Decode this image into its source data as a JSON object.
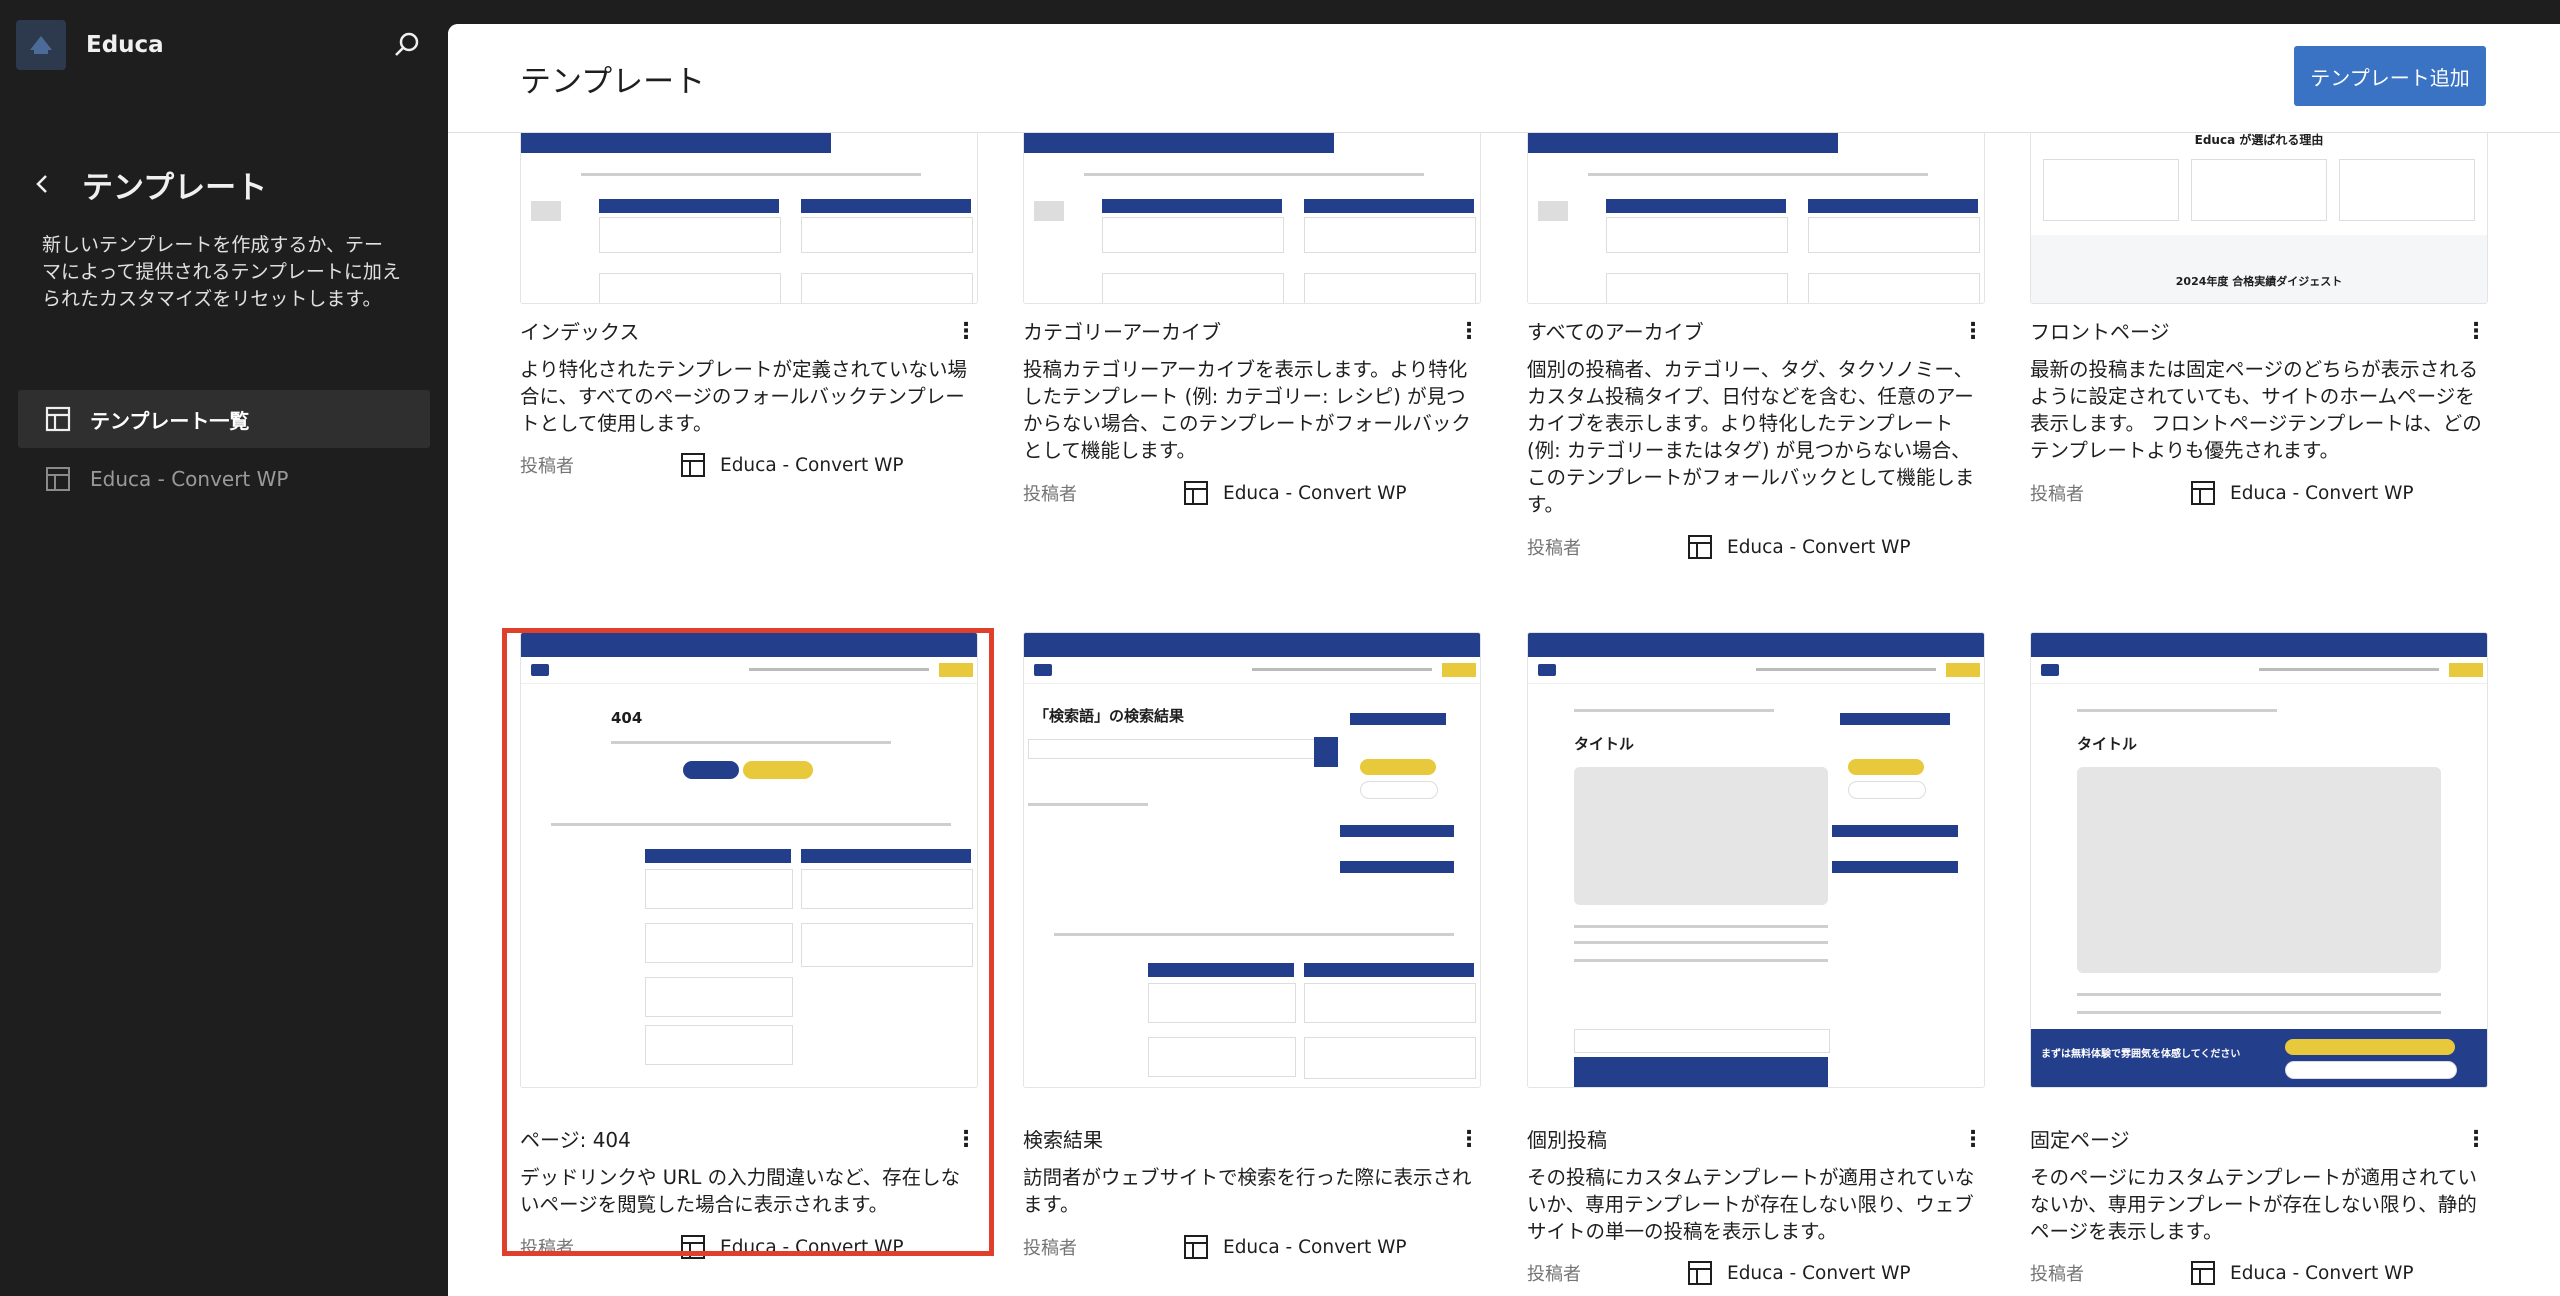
{
  "sidebar": {
    "site_name": "Educa",
    "title": "テンプレート",
    "description": "新しいテンプレートを作成するか、テーマによって提供されるテンプレートに加えられたカスタマイズをリセットします。",
    "items": [
      {
        "label": "テンプレート一覧",
        "active": true
      },
      {
        "label": "Educa - Convert WP",
        "active": false
      }
    ]
  },
  "header": {
    "title": "テンプレート",
    "add_button": "テンプレート追加"
  },
  "meta_label": "投稿者",
  "templates": [
    {
      "title": "インデックス",
      "description": "より特化されたテンプレートが定義されていない場合に、すべてのページのフォールバックテンプレートとして使用します。",
      "author": "Educa - Convert WP"
    },
    {
      "title": "カテゴリーアーカイブ",
      "description": "投稿カテゴリーアーカイブを表示します。より特化したテンプレート (例: カテゴリー: レシピ) が見つからない場合、このテンプレートがフォールバックとして機能します。",
      "author": "Educa - Convert WP"
    },
    {
      "title": "すべてのアーカイブ",
      "description": "個別の投稿者、カテゴリー、タグ、タクソノミー、カスタム投稿タイプ、日付などを含む、任意のアーカイブを表示します。より特化したテンプレート (例: カテゴリーまたはタグ) が見つからない場合、このテンプレートがフォールバックとして機能します。",
      "author": "Educa - Convert WP"
    },
    {
      "title": "フロントページ",
      "description": "最新の投稿または固定ページのどちらが表示されるように設定されていても、サイトのホームページを表示します。 フロントページテンプレートは、どのテンプレートよりも優先されます。",
      "author": "Educa - Convert WP"
    },
    {
      "title": "ページ: 404",
      "description": "デッドリンクや URL の入力間違いなど、存在しないページを閲覧した場合に表示されます。",
      "author": "Educa - Convert WP"
    },
    {
      "title": "検索結果",
      "description": "訪問者がウェブサイトで検索を行った際に表示されます。",
      "author": "Educa - Convert WP"
    },
    {
      "title": "個別投稿",
      "description": "その投稿にカスタムテンプレートが適用されていないか、専用テンプレートが存在しない限り、ウェブサイトの単一の投稿を表示します。",
      "author": "Educa - Convert WP"
    },
    {
      "title": "固定ページ",
      "description": "そのページにカスタムテンプレートが適用されていないか、専用テンプレートが存在しない限り、静的ページを表示します。",
      "author": "Educa - Convert WP"
    }
  ],
  "previews": {
    "front_heading": "Educa が選ばれる理由",
    "front_sub": "2024年度 合格実績ダイジェスト",
    "p404_heading": "404",
    "search_heading": "「検索語」の検索結果",
    "post_heading": "タイトル",
    "page_heading": "タイトル",
    "page_banner": "まずは無料体験で雰囲気を体感してください"
  },
  "colors": {
    "accent": "#3b73c4",
    "highlight": "#e0402b",
    "preview_blue": "#233e8b",
    "preview_yellow": "#e8c93b"
  }
}
